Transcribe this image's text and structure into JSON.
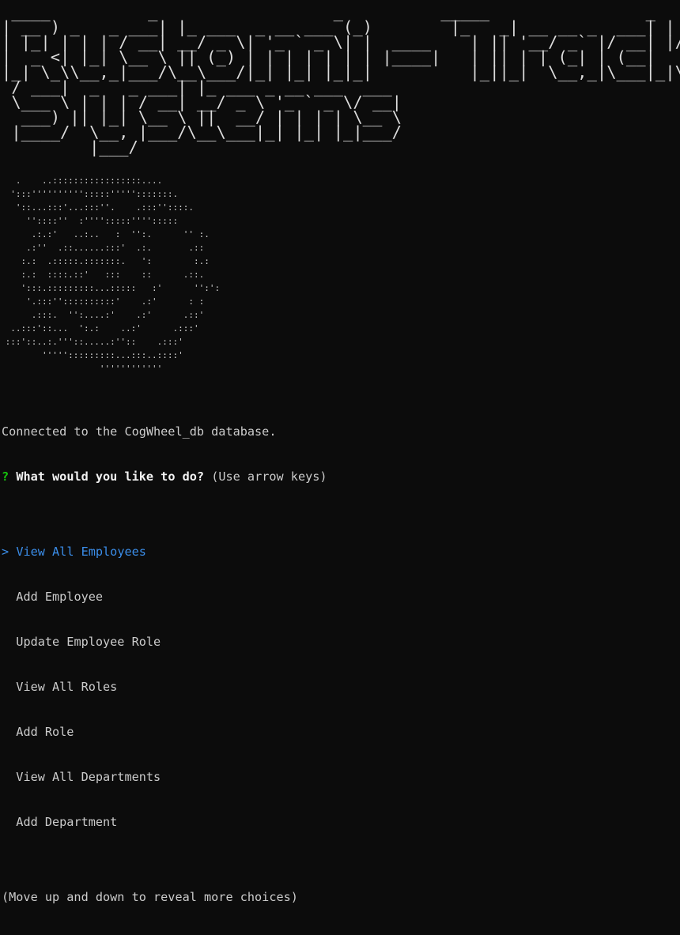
{
  "banner": {
    "lines": [
      " ____          _                  _          _____                _",
      "| __ ) _   _ ___| |_ ___  _ __ ___ (_)        |_   _| __ __ _  ___| | __",
      "| |_| | | | / __| __/ _ \\| '_ ` _ \\| |  ____    | || '__/ _` |/ __| |/ /",
      "|  _ <| |_| \\__ \\ || (_) | | | | | | | |____|   | || | | (_| | (__|   <",
      "|_| \\_\\\\__,_|___/\\__\\___/|_| |_| |_|_|          |_||_|  \\__,_|\\___|_|\\_\\",
      " / ___|  _   _ ___| |_ ___ _ __ ___  ___",
      " \\___ \\ | | | / __| __/ _ \\ '_ ` _ \\/ __|",
      "  ___) || |_| \\__ \\ ||  __/ | | | | \\__ \\",
      " |____/  \\__, |___/\\__\\___|_| |_| |_|___/",
      "         |___/"
    ]
  },
  "logo": {
    "lines": [
      "   .    ..:::::::::::::::::....",
      "  ':::'''''''''':::::''''':::::::.",
      "   '::...:::'...:::''.    .:::''::::.",
      "     ''::::''  :'''':::::'''':::::",
      "      .:.:'   ..:..   :  '':.      '' :.",
      "     .:''  .::......:::'  .:.       .::",
      "    :.:  .:::::.:::::::.   ':        :.:",
      "    :.:  ::::.::'   :::    ::      .::.",
      "    ':::.:::::::::...:::::   :'      '':':",
      "     '.:::''::::::::::'    .:'      : :",
      "      .:::.  '':....:'    .:'      .::'",
      "  ..:::'::...  ':.:    ..:'      .:::'",
      " :::'::..:.'''::.....:''::    .:::'",
      "        ''''':::::::::...:::..::::'",
      "                   '''''''''''' "
    ]
  },
  "terminal": {
    "status_line": "Connected to the CogWheel_db database.",
    "prompt": {
      "mark": "?",
      "question": "What would you like to do?",
      "hint": "(Use arrow keys)"
    },
    "pointer": ">",
    "choices": [
      {
        "label": "View All Employees",
        "selected": true
      },
      {
        "label": "Add Employee",
        "selected": false
      },
      {
        "label": "Update Employee Role",
        "selected": false
      },
      {
        "label": "View All Roles",
        "selected": false
      },
      {
        "label": "Add Role",
        "selected": false
      },
      {
        "label": "View All Departments",
        "selected": false
      },
      {
        "label": "Add Department",
        "selected": false
      }
    ],
    "footer_hint": "(Move up and down to reveal more choices)"
  },
  "colors": {
    "background": "#0c0c0c",
    "text": "#cccccc",
    "selected": "#3b8eea",
    "question_mark": "#16c60c"
  }
}
